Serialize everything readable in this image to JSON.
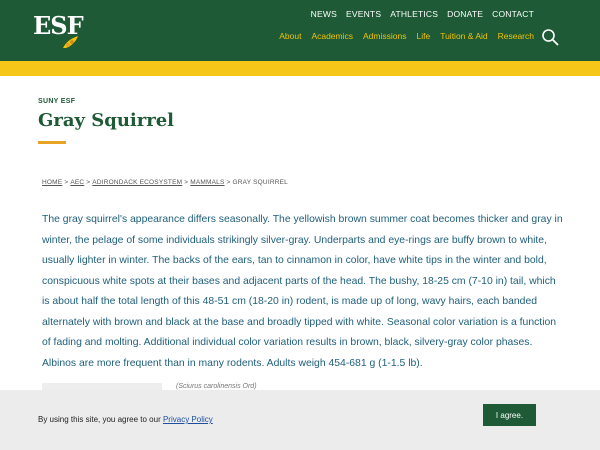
{
  "header": {
    "logo_text": "ESF",
    "top_nav": [
      "NEWS",
      "EVENTS",
      "ATHLETICS",
      "DONATE",
      "CONTACT"
    ],
    "main_nav": [
      "About",
      "Academics",
      "Admissions",
      "Life",
      "Tuition & Aid",
      "Research"
    ],
    "search_icon": "search-icon"
  },
  "colors": {
    "brand_green": "#1d5a35",
    "accent_yellow": "#f5c518",
    "underline_orange": "#e8a224",
    "body_text": "#1f5f7a"
  },
  "page": {
    "eyebrow": "SUNY ESF",
    "title": "Gray Squirrel"
  },
  "breadcrumb": [
    "HOME",
    "AEC",
    "ADIRONDACK ECOSYSTEM",
    "MAMMALS",
    "GRAY SQUIRREL"
  ],
  "body": {
    "paragraph": "The gray squirrel's appearance differs seasonally. The yellowish brown summer coat becomes thicker and gray in winter, the pelage of some individuals strikingly silver-gray. Underparts and eye-rings are buffy brown to white, usually lighter in winter.  The backs of the ears, tan to cinnamon in color, have white tips in the winter and bold, conspicuous white spots at their bases and adjacent parts of the head. The bushy, 18-25 cm (7-10 in) tail, which is about half the total length of this 48-51 cm (18-20 in) rodent, is made up of long, wavy hairs, each banded alternately with brown and black at the base and broadly tipped with white. Seasonal color variation is a function of fading and molting. Additional individual color variation results in brown, black, silvery-gray color phases. Albinos are more frequent than in many rodents. Adults weigh 454-681 g (1-1.5 lb)."
  },
  "figure": {
    "caption": "(Sciurus carolinensis Ord)"
  },
  "cookie": {
    "text": "By using this site, you agree to our ",
    "link": "Privacy Policy",
    "button": "I agree."
  }
}
